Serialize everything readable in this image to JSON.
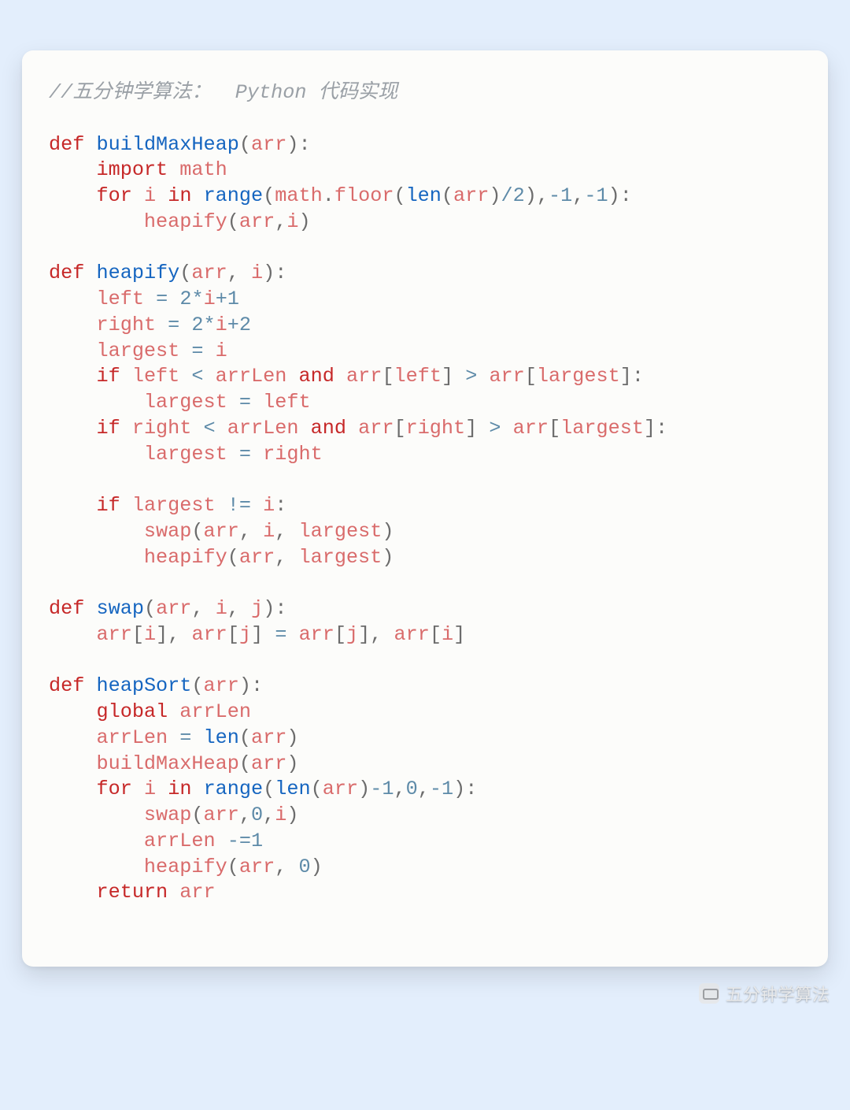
{
  "comment": "//五分钟学算法：  Python 代码实现",
  "watermark": "五分钟学算法",
  "code": {
    "functions": [
      {
        "name": "buildMaxHeap",
        "params": [
          "arr"
        ],
        "body": [
          "import math",
          "for i in range(math.floor(len(arr)/2),-1,-1):",
          "    heapify(arr,i)"
        ]
      },
      {
        "name": "heapify",
        "params": [
          "arr",
          "i"
        ],
        "body": [
          "left = 2*i+1",
          "right = 2*i+2",
          "largest = i",
          "if left < arrLen and arr[left] > arr[largest]:",
          "    largest = left",
          "if right < arrLen and arr[right] > arr[largest]:",
          "    largest = right",
          "",
          "if largest != i:",
          "    swap(arr, i, largest)",
          "    heapify(arr, largest)"
        ]
      },
      {
        "name": "swap",
        "params": [
          "arr",
          "i",
          "j"
        ],
        "body": [
          "arr[i], arr[j] = arr[j], arr[i]"
        ]
      },
      {
        "name": "heapSort",
        "params": [
          "arr"
        ],
        "body": [
          "global arrLen",
          "arrLen = len(arr)",
          "buildMaxHeap(arr)",
          "for i in range(len(arr)-1,0,-1):",
          "    swap(arr,0,i)",
          "    arrLen -=1",
          "    heapify(arr, 0)",
          "return arr"
        ]
      }
    ]
  },
  "tokens": {
    "def": "def",
    "import": "import",
    "for": "for",
    "in": "in",
    "if": "if",
    "and": "and",
    "global": "global",
    "return": "return",
    "math": "math",
    "floor": "floor",
    "len": "len",
    "range": "range",
    "arr": "arr",
    "i": "i",
    "j": "j",
    "left": "left",
    "right": "right",
    "largest": "largest",
    "arrLen": "arrLen",
    "n0": "0",
    "n1": "1",
    "n2": "2",
    "nm1": "-1",
    "lp": "(",
    "rp": ")",
    "lb": "[",
    "rb": "]",
    "col": ":",
    "com": ",",
    "dot": ".",
    "eq": "=",
    "lt": "<",
    "gt": ">",
    "ne": "!=",
    "div": "/",
    "mul": "*",
    "plus": "+",
    "sub": "-",
    "meq": "-="
  }
}
